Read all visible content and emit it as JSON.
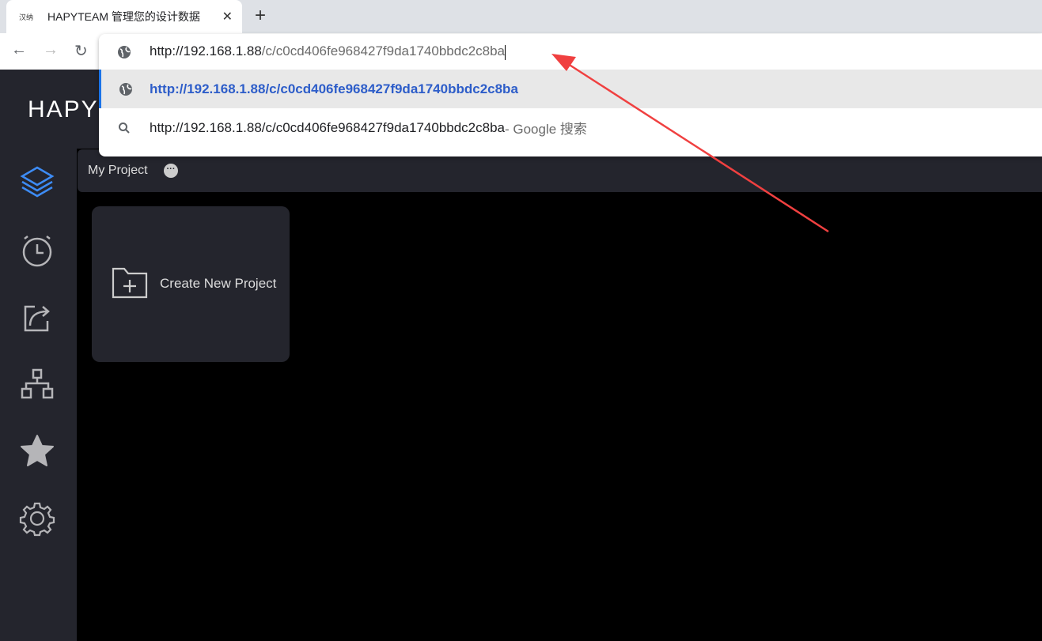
{
  "browser": {
    "tab": {
      "favicon_text": "汉纳",
      "title": "HAPYTEAM 管理您的设计数据"
    },
    "address": {
      "host": "http://192.168.1.88",
      "path": "/c/c0cd406fe968427f9da1740bbdc2c8ba"
    },
    "suggestions": [
      {
        "icon": "globe-icon",
        "text": "http://192.168.1.88/c/c0cd406fe968427f9da1740bbdc2c8ba",
        "suffix": ""
      },
      {
        "icon": "search-icon",
        "text": "http://192.168.1.88/c/c0cd406fe968427f9da1740bbdc2c8ba",
        "suffix": " - Google 搜索"
      }
    ]
  },
  "app": {
    "brand": "HAPY",
    "sidebar": [
      "layers-icon",
      "alarm-clock-icon",
      "share-icon",
      "hierarchy-icon",
      "star-icon",
      "gear-icon"
    ],
    "active_color": "#3d8cf5",
    "project_bar": {
      "title": "My Project"
    },
    "card": {
      "label": "Create New Project"
    }
  },
  "annotation": {
    "color": "#f04040"
  }
}
